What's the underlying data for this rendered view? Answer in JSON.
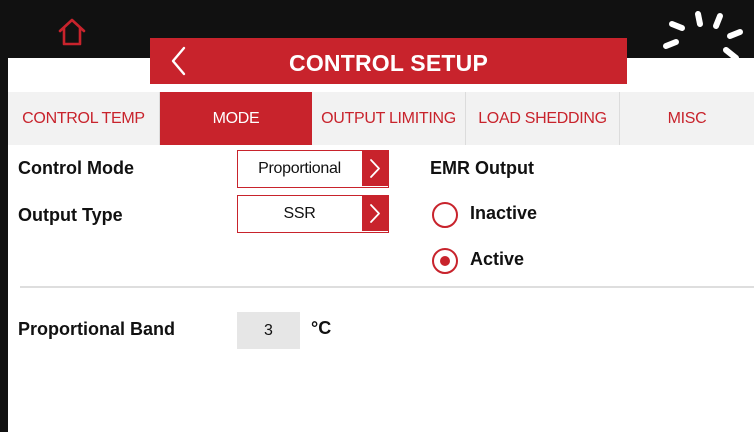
{
  "header": {
    "title": "CONTROL SETUP",
    "home_icon": "home-icon",
    "back_icon": "chevron-left-icon",
    "loading_icon": "spinner-icon"
  },
  "tabs": [
    {
      "label": "CONTROL TEMP",
      "active": false
    },
    {
      "label": "MODE",
      "active": true
    },
    {
      "label": "OUTPUT LIMITING",
      "active": false
    },
    {
      "label": "LOAD SHEDDING",
      "active": false
    },
    {
      "label": "MISC",
      "active": false
    }
  ],
  "settings": {
    "control_mode": {
      "label": "Control Mode",
      "value": "Proportional"
    },
    "output_type": {
      "label": "Output Type",
      "value": "SSR"
    },
    "emr_output": {
      "label": "EMR Output",
      "options": [
        {
          "label": "Inactive",
          "selected": false
        },
        {
          "label": "Active",
          "selected": true
        }
      ]
    },
    "proportional_band": {
      "label": "Proportional Band",
      "value": "3",
      "unit": "°C"
    }
  },
  "colors": {
    "accent": "#c8232c",
    "frame": "#111111",
    "tab_bg": "#f2f2f2",
    "field_bg": "#e6e6e6"
  }
}
